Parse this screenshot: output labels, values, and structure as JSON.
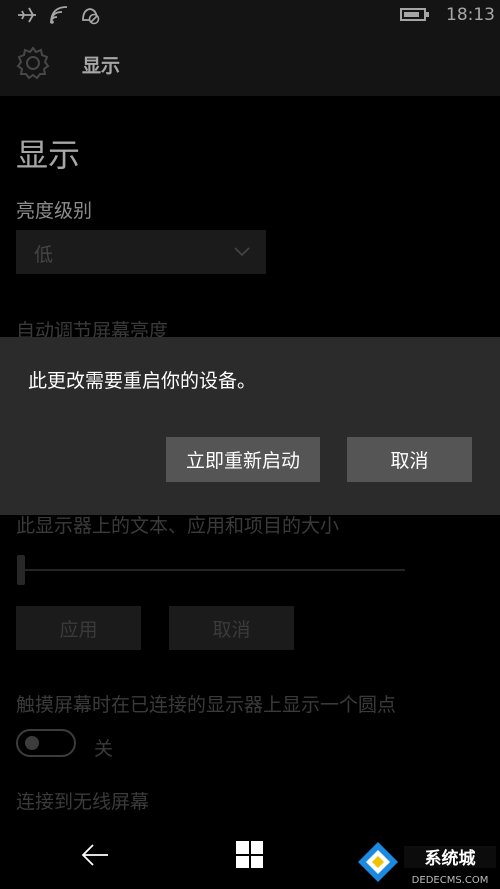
{
  "status_bar": {
    "icons": [
      "airplane-mode-icon",
      "wifi-icon",
      "quiet-hours-icon"
    ],
    "battery_level": 0.7,
    "time": "18:13"
  },
  "header": {
    "icon": "gear-icon",
    "title": "显示"
  },
  "page": {
    "title": "显示",
    "brightness_label": "亮度级别",
    "brightness_value": "低",
    "auto_brightness_label": "自动调节屏幕亮度",
    "scale_label": "此显示器上的文本、应用和项目的大小",
    "scale_slider_value": 0,
    "apply_button": "应用",
    "cancel_button": "取消",
    "touch_dot_label": "触摸屏幕时在已连接的显示器上显示一个圆点",
    "touch_dot_toggle": "关",
    "wireless_display_label": "连接到无线屏幕"
  },
  "dialog": {
    "message": "此更改需要重启你的设备。",
    "restart_button": "立即重新启动",
    "cancel_button": "取消"
  },
  "nav_bar": {
    "icons": [
      "back-arrow-icon",
      "windows-start-icon",
      "search-icon"
    ]
  },
  "watermark": {
    "text_line1": "系统城",
    "text_line2": "DEDECMS.COM"
  }
}
